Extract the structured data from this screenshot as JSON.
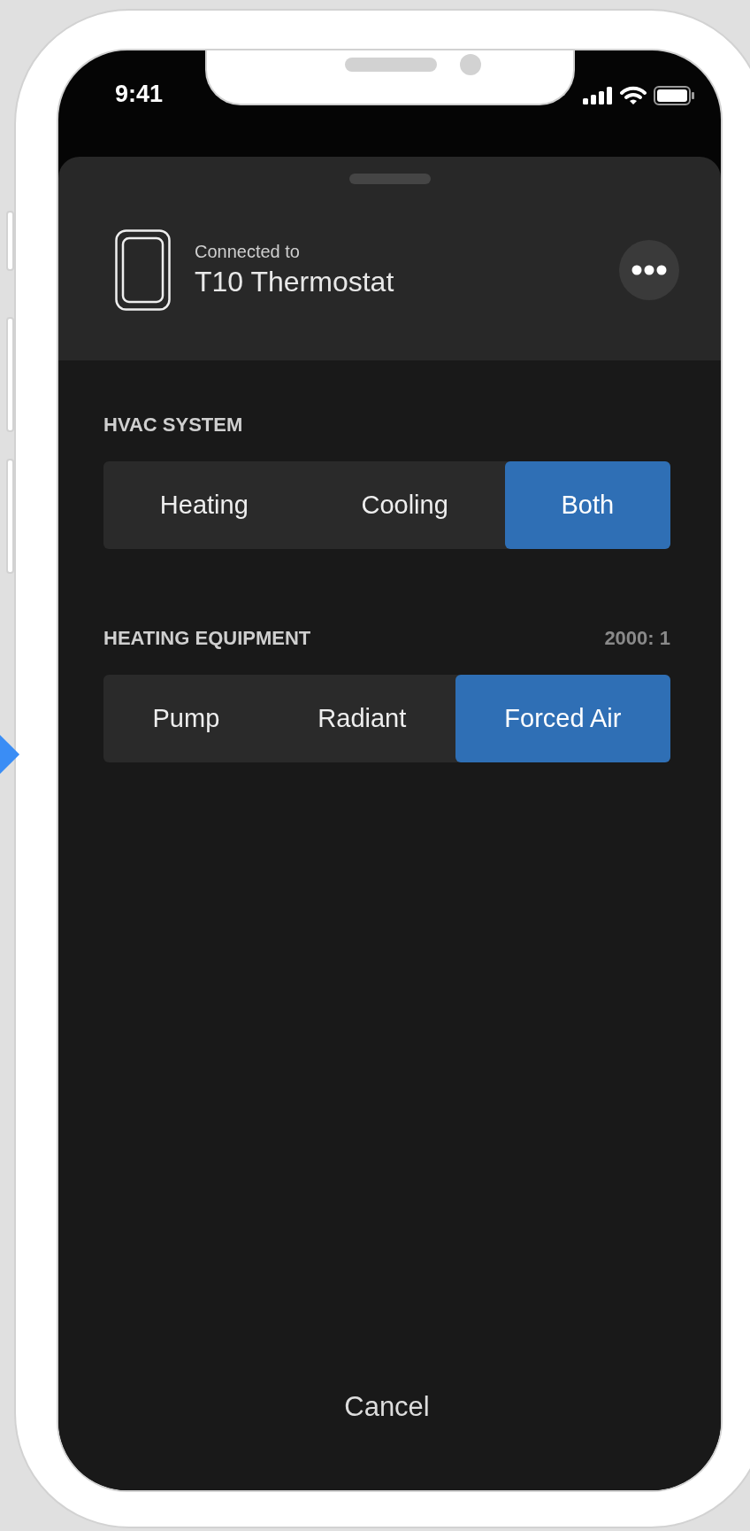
{
  "status_bar": {
    "time": "9:41"
  },
  "header": {
    "subtitle": "Connected to",
    "title": "T10 Thermostat"
  },
  "sections": [
    {
      "title": "HVAC SYSTEM",
      "options": [
        {
          "label": "Heating",
          "selected": false
        },
        {
          "label": "Cooling",
          "selected": false
        },
        {
          "label": "Both",
          "selected": true
        }
      ]
    },
    {
      "title": "HEATING EQUIPMENT",
      "value": "2000: 1",
      "options": [
        {
          "label": "Pump",
          "selected": false
        },
        {
          "label": "Radiant",
          "selected": false
        },
        {
          "label": "Forced Air",
          "selected": true
        }
      ]
    }
  ],
  "cancel_button": "Cancel"
}
